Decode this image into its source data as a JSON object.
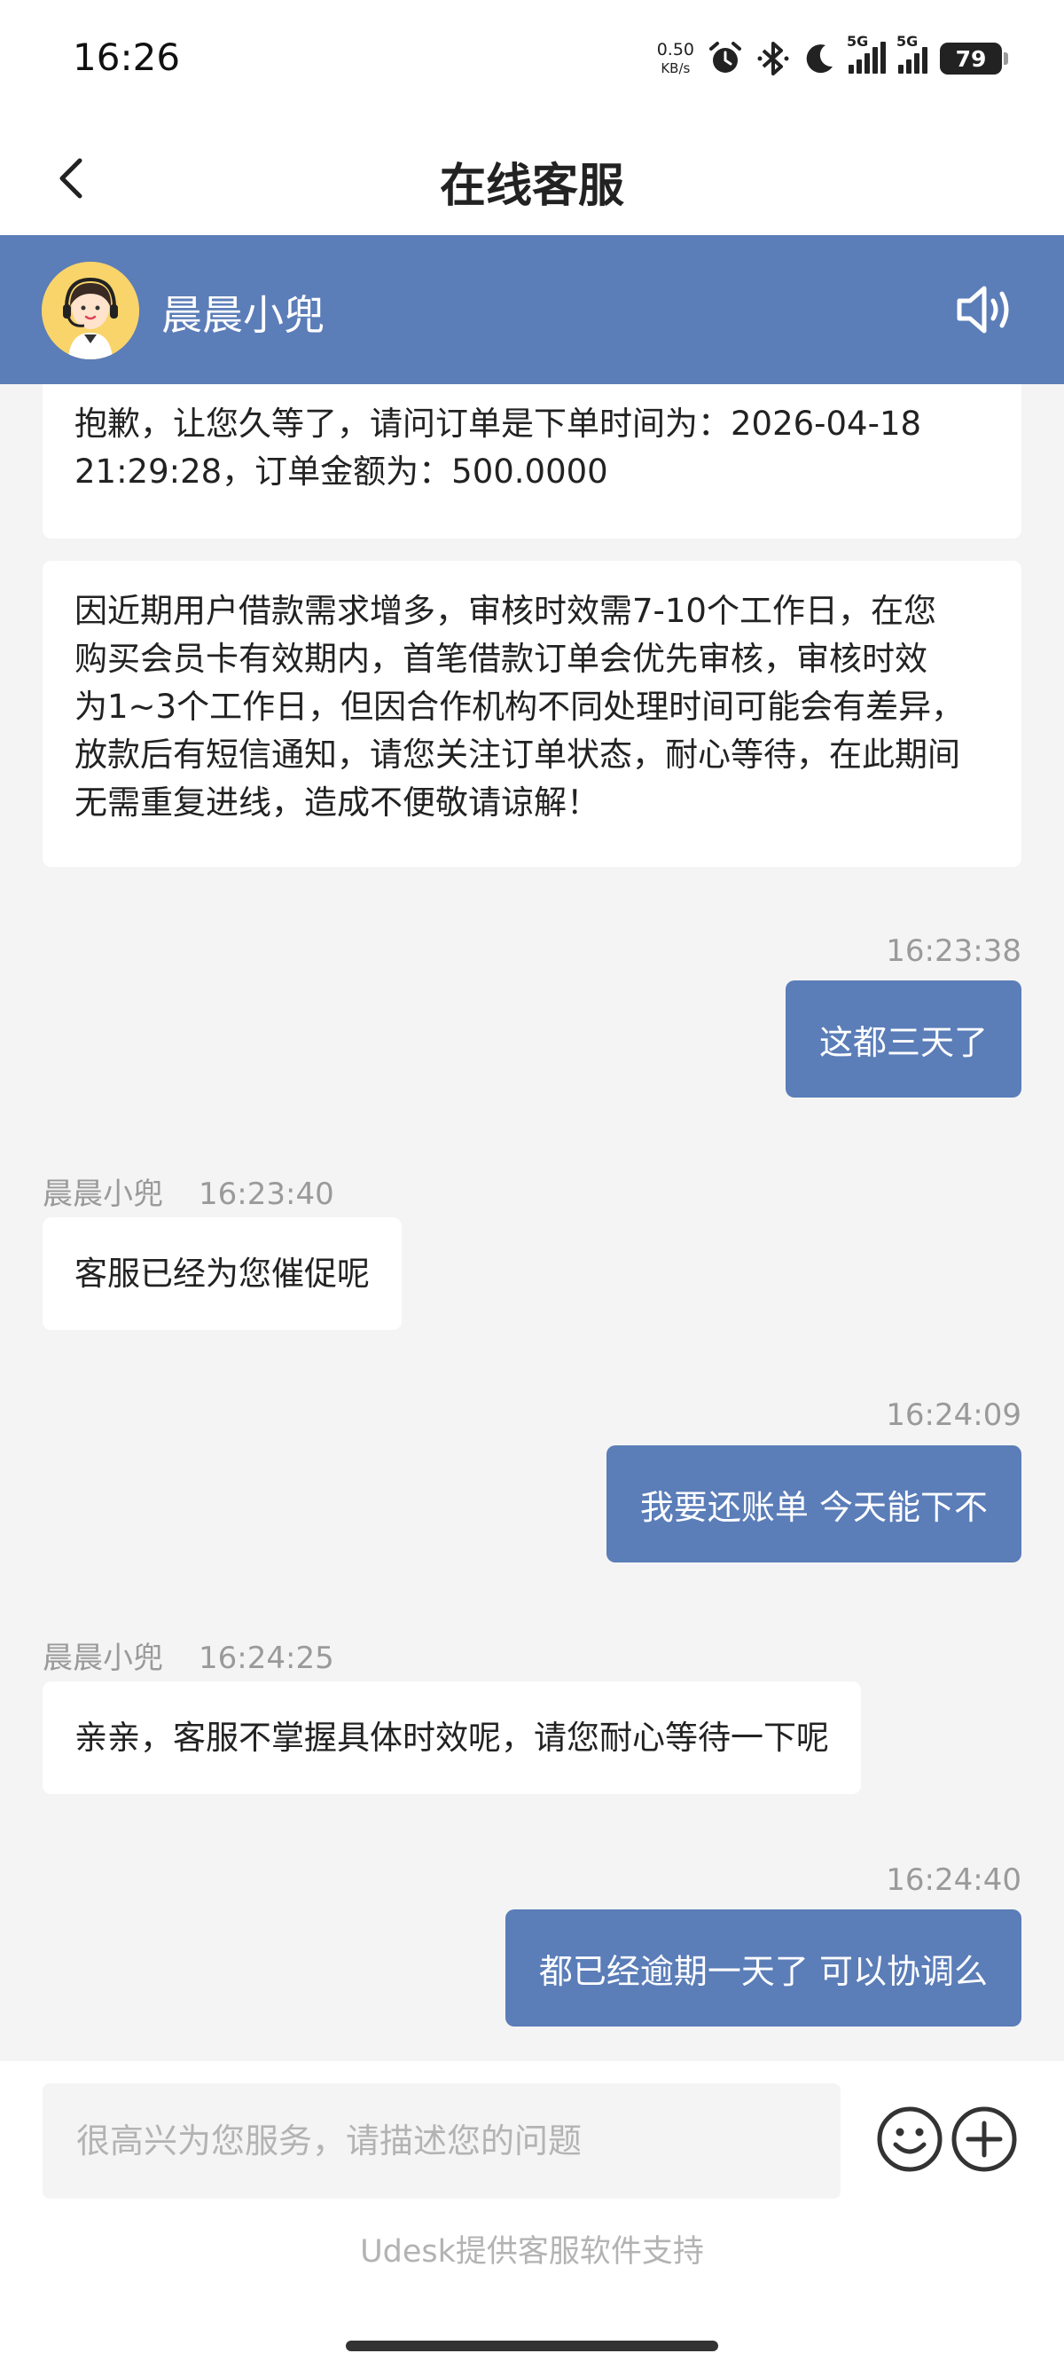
{
  "status_bar": {
    "time": "16:26",
    "net_speed_value": "0.50",
    "net_speed_unit": "KB/s",
    "battery": "79",
    "signal_1": "5G",
    "signal_2": "5G",
    "icons": [
      "alarm-icon",
      "bluetooth-icon",
      "moon-icon",
      "signal-icon",
      "battery-icon"
    ]
  },
  "header": {
    "title": "在线客服"
  },
  "agent": {
    "name": "晨晨小兜"
  },
  "messages": [
    {
      "side": "agent",
      "text_lines": [
        "抱歉，让您久等了，请问订单是下单时间为：2026-04-18",
        "21:29:28，订单金额为：500.0000"
      ]
    },
    {
      "side": "agent",
      "text_lines": [
        "因近期用户借款需求增多，审核时效需7-10个工作日，在您",
        "购买会员卡有效期内，首笔借款订单会优先审核，审核时效",
        "为1~3个工作日，但因合作机构不同处理时间可能会有差异，",
        "放款后有短信通知，请您关注订单状态，耐心等待，在此期间",
        "无需重复进线，造成不便敬请谅解！"
      ]
    },
    {
      "side": "user",
      "time": "16:23:38",
      "text": "这都三天了"
    },
    {
      "side": "agent",
      "sender": "晨晨小兜",
      "time": "16:23:40",
      "text": "客服已经为您催促呢"
    },
    {
      "side": "user",
      "time": "16:24:09",
      "text": "我要还账单 今天能下不"
    },
    {
      "side": "agent",
      "sender": "晨晨小兜",
      "time": "16:24:25",
      "text": "亲亲，客服不掌握具体时效呢，请您耐心等待一下呢"
    },
    {
      "side": "user",
      "time": "16:24:40",
      "text": "都已经逾期一天了 可以协调么"
    }
  ],
  "composer": {
    "placeholder": "很高兴为您服务，请描述您的问题",
    "powered_by": "Udesk提供客服软件支持"
  },
  "colors": {
    "brand_blue": "#5b7db8",
    "background": "#f4f4f4",
    "timestamp_gray": "#9a9a9a"
  }
}
